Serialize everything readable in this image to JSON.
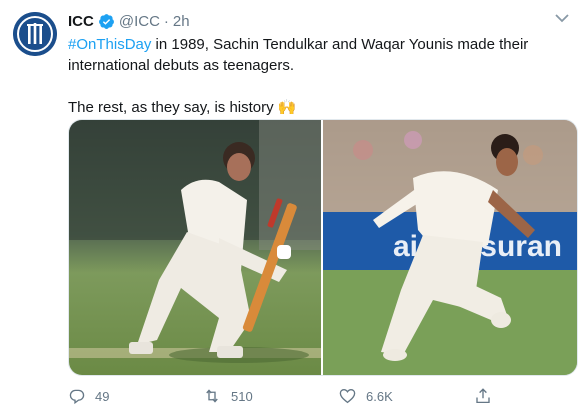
{
  "tweet": {
    "author_name": "ICC",
    "handle": "@ICC",
    "separator": "·",
    "time": "2h",
    "text": {
      "hashtag": "#OnThisDay",
      "line1_rest": " in 1989, Sachin Tendulkar and Waqar Younis made their international debuts as teenagers.",
      "line2": "The rest, as they say, is history 🙌"
    },
    "media": [
      {
        "name": "batsman-photo"
      },
      {
        "name": "bowler-photo"
      }
    ]
  },
  "actions": {
    "reply_count": "49",
    "retweet_count": "510",
    "like_count": "6.6K"
  },
  "colors": {
    "accent": "#1da1f2",
    "text_secondary": "#657786"
  }
}
